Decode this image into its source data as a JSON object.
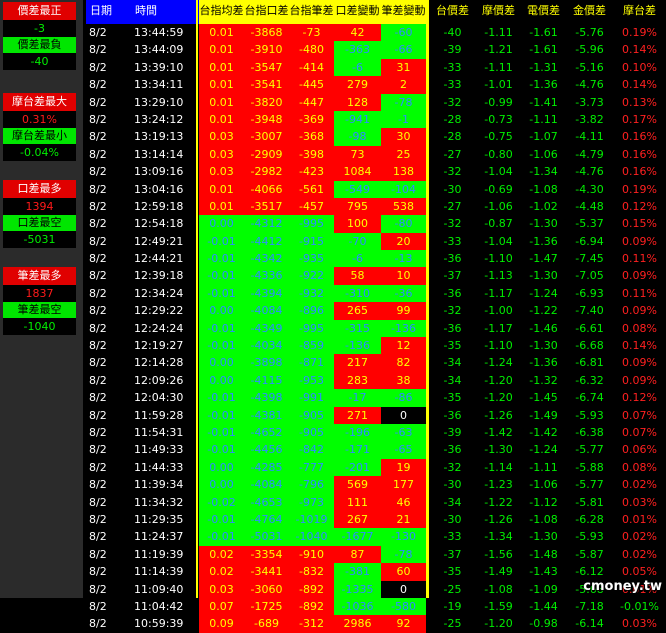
{
  "left_panel": {
    "block1": {
      "title": "價差最正",
      "v1": "-3",
      "sub": "價差最負",
      "v2": "-40"
    },
    "block2": {
      "title": "摩台差最大",
      "v1": "0.31%",
      "sub": "摩台差最小",
      "v2": "-0.04%"
    },
    "block3": {
      "title": "口差最多",
      "v1": "1394",
      "sub": "口差最空",
      "v2": "-5031"
    },
    "block4": {
      "title": "筆差最多",
      "v1": "1837",
      "sub": "筆差最空",
      "v2": "-1040"
    }
  },
  "columns": [
    "日期",
    "時間",
    "台指均差",
    "台指口差",
    "台指筆差",
    "口差變動",
    "筆差變動",
    "台價差",
    "摩價差",
    "電價差",
    "金價差",
    "摩台差"
  ],
  "rows": [
    [
      "8/2",
      "13:44:59",
      "0.01",
      "-3868",
      "-73",
      "42",
      "-60",
      "-40",
      "-1.11",
      "-1.61",
      "-5.76",
      "0.19%"
    ],
    [
      "8/2",
      "13:44:09",
      "0.01",
      "-3910",
      "-480",
      "-363",
      "-66",
      "-39",
      "-1.21",
      "-1.61",
      "-5.96",
      "0.14%"
    ],
    [
      "8/2",
      "13:39:10",
      "0.01",
      "-3547",
      "-414",
      "-6",
      "31",
      "-33",
      "-1.11",
      "-1.31",
      "-5.16",
      "0.10%"
    ],
    [
      "8/2",
      "13:34:11",
      "0.01",
      "-3541",
      "-445",
      "279",
      "2",
      "-33",
      "-1.01",
      "-1.36",
      "-4.76",
      "0.14%"
    ],
    [
      "8/2",
      "13:29:10",
      "0.01",
      "-3820",
      "-447",
      "128",
      "-78",
      "-32",
      "-0.99",
      "-1.41",
      "-3.73",
      "0.13%"
    ],
    [
      "8/2",
      "13:24:12",
      "0.01",
      "-3948",
      "-369",
      "-941",
      "-1",
      "-28",
      "-0.73",
      "-1.11",
      "-3.82",
      "0.17%"
    ],
    [
      "8/2",
      "13:19:13",
      "0.03",
      "-3007",
      "-368",
      "-98",
      "30",
      "-28",
      "-0.75",
      "-1.07",
      "-4.11",
      "0.16%"
    ],
    [
      "8/2",
      "13:14:14",
      "0.03",
      "-2909",
      "-398",
      "73",
      "25",
      "-27",
      "-0.80",
      "-1.06",
      "-4.79",
      "0.16%"
    ],
    [
      "8/2",
      "13:09:16",
      "0.03",
      "-2982",
      "-423",
      "1084",
      "138",
      "-32",
      "-1.04",
      "-1.34",
      "-4.76",
      "0.16%"
    ],
    [
      "8/2",
      "13:04:16",
      "0.01",
      "-4066",
      "-561",
      "-549",
      "-104",
      "-30",
      "-0.69",
      "-1.08",
      "-4.30",
      "0.19%"
    ],
    [
      "8/2",
      "12:59:18",
      "0.01",
      "-3517",
      "-457",
      "795",
      "538",
      "-27",
      "-1.06",
      "-1.02",
      "-4.48",
      "0.12%"
    ],
    [
      "8/2",
      "12:54:18",
      "0.00",
      "-4312",
      "-995",
      "100",
      "-80",
      "-32",
      "-0.87",
      "-1.30",
      "-5.37",
      "0.15%"
    ],
    [
      "8/2",
      "12:49:21",
      "-0.01",
      "-4412",
      "-915",
      "-70",
      "20",
      "-33",
      "-1.04",
      "-1.36",
      "-6.94",
      "0.09%"
    ],
    [
      "8/2",
      "12:44:21",
      "-0.01",
      "-4342",
      "-935",
      "-6",
      "-13",
      "-36",
      "-1.10",
      "-1.47",
      "-7.45",
      "0.11%"
    ],
    [
      "8/2",
      "12:39:18",
      "-0.01",
      "-4336",
      "-922",
      "58",
      "10",
      "-37",
      "-1.13",
      "-1.30",
      "-7.05",
      "0.09%"
    ],
    [
      "8/2",
      "12:34:24",
      "-0.01",
      "-4394",
      "-932",
      "-310",
      "-36",
      "-36",
      "-1.17",
      "-1.24",
      "-6.93",
      "0.11%"
    ],
    [
      "8/2",
      "12:29:22",
      "0.00",
      "-4084",
      "-896",
      "265",
      "99",
      "-32",
      "-1.00",
      "-1.22",
      "-7.40",
      "0.09%"
    ],
    [
      "8/2",
      "12:24:24",
      "-0.01",
      "-4349",
      "-995",
      "-315",
      "-136",
      "-36",
      "-1.17",
      "-1.46",
      "-6.61",
      "0.08%"
    ],
    [
      "8/2",
      "12:19:27",
      "-0.01",
      "-4034",
      "-859",
      "-136",
      "12",
      "-35",
      "-1.10",
      "-1.30",
      "-6.68",
      "0.14%"
    ],
    [
      "8/2",
      "12:14:28",
      "0.00",
      "-3898",
      "-871",
      "217",
      "82",
      "-34",
      "-1.24",
      "-1.36",
      "-6.81",
      "0.09%"
    ],
    [
      "8/2",
      "12:09:26",
      "0.00",
      "-4115",
      "-953",
      "283",
      "38",
      "-34",
      "-1.20",
      "-1.32",
      "-6.32",
      "0.09%"
    ],
    [
      "8/2",
      "12:04:30",
      "-0.01",
      "-4398",
      "-991",
      "-17",
      "-86",
      "-35",
      "-1.20",
      "-1.45",
      "-6.74",
      "0.12%"
    ],
    [
      "8/2",
      "11:59:28",
      "-0.01",
      "-4381",
      "-905",
      "271",
      "0",
      "-36",
      "-1.26",
      "-1.49",
      "-5.93",
      "0.07%"
    ],
    [
      "8/2",
      "11:54:31",
      "-0.01",
      "-4652",
      "-905",
      "-196",
      "-63",
      "-39",
      "-1.42",
      "-1.42",
      "-6.38",
      "0.07%"
    ],
    [
      "8/2",
      "11:49:33",
      "-0.01",
      "-4456",
      "-842",
      "-171",
      "-65",
      "-36",
      "-1.30",
      "-1.24",
      "-5.77",
      "0.06%"
    ],
    [
      "8/2",
      "11:44:33",
      "0.00",
      "-4285",
      "-777",
      "-201",
      "19",
      "-32",
      "-1.14",
      "-1.11",
      "-5.88",
      "0.08%"
    ],
    [
      "8/2",
      "11:39:34",
      "0.00",
      "-4084",
      "-796",
      "569",
      "177",
      "-30",
      "-1.23",
      "-1.06",
      "-5.77",
      "0.02%"
    ],
    [
      "8/2",
      "11:34:32",
      "-0.02",
      "-4653",
      "-973",
      "111",
      "46",
      "-34",
      "-1.22",
      "-1.12",
      "-5.81",
      "0.03%"
    ],
    [
      "8/2",
      "11:29:35",
      "-0.01",
      "-4764",
      "-1019",
      "267",
      "21",
      "-30",
      "-1.26",
      "-1.08",
      "-6.28",
      "0.01%"
    ],
    [
      "8/2",
      "11:24:37",
      "-0.01",
      "-5031",
      "-1040",
      "-1677",
      "-130",
      "-33",
      "-1.34",
      "-1.30",
      "-5.93",
      "0.02%"
    ],
    [
      "8/2",
      "11:19:39",
      "0.02",
      "-3354",
      "-910",
      "87",
      "-78",
      "-37",
      "-1.56",
      "-1.48",
      "-5.87",
      "0.02%"
    ],
    [
      "8/2",
      "11:14:39",
      "0.02",
      "-3441",
      "-832",
      "-381",
      "60",
      "-35",
      "-1.49",
      "-1.43",
      "-6.12",
      "0.05%"
    ],
    [
      "8/2",
      "11:09:40",
      "0.03",
      "-3060",
      "-892",
      "-1335",
      "0",
      "-25",
      "-1.08",
      "-1.09",
      "-5.68",
      "0.01%"
    ],
    [
      "8/2",
      "11:04:42",
      "0.07",
      "-1725",
      "-892",
      "-1036",
      "-580",
      "-19",
      "-1.59",
      "-1.44",
      "-7.18",
      "-0.01%"
    ],
    [
      "8/2",
      "10:59:39",
      "0.09",
      "-689",
      "-312",
      "2986",
      "92",
      "-25",
      "-1.20",
      "-0.98",
      "-6.14",
      "0.03%"
    ]
  ],
  "watermark": "cmoney.tw"
}
